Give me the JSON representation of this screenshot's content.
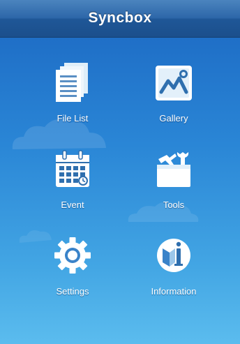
{
  "header": {
    "title": "Syncbox"
  },
  "menu": [
    {
      "label": "File List",
      "icon": "file-list-icon"
    },
    {
      "label": "Gallery",
      "icon": "gallery-icon"
    },
    {
      "label": "Event",
      "icon": "calendar-icon"
    },
    {
      "label": "Tools",
      "icon": "toolbox-icon"
    },
    {
      "label": "Settings",
      "icon": "gear-icon"
    },
    {
      "label": "Information",
      "icon": "info-icon"
    }
  ],
  "colors": {
    "header": "#2d67a9",
    "background_top": "#1f6fc7",
    "background_bottom": "#5bbcee",
    "icon_fill": "#ffffff"
  }
}
